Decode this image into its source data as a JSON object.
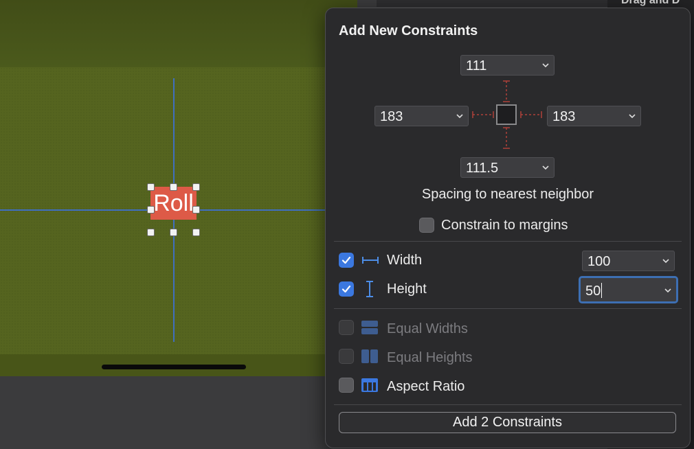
{
  "inspector": {
    "title": "Drag and D"
  },
  "canvas": {
    "button_text": "Roll"
  },
  "popover": {
    "title": "Add New Constraints",
    "spacing": {
      "top": "111",
      "left": "183",
      "right": "183",
      "bottom": "111.5"
    },
    "spacing_label": "Spacing to nearest neighbor",
    "constrain_margins_label": "Constrain to margins",
    "width": {
      "label": "Width",
      "value": "100",
      "checked": true
    },
    "height": {
      "label": "Height",
      "value": "50",
      "checked": true
    },
    "equal_widths_label": "Equal Widths",
    "equal_heights_label": "Equal Heights",
    "aspect_ratio_label": "Aspect Ratio",
    "add_button_label": "Add 2 Constraints"
  },
  "colors": {
    "accent": "#3b78e0",
    "constraint_red": "#b0413a",
    "button_red": "#dd5a47"
  },
  "icons": {
    "width": "width-constraint-icon",
    "height": "height-constraint-icon",
    "equal_widths": "equal-widths-icon",
    "equal_heights": "equal-heights-icon",
    "aspect_ratio": "aspect-ratio-icon",
    "chevron": "chevron-down-icon"
  }
}
